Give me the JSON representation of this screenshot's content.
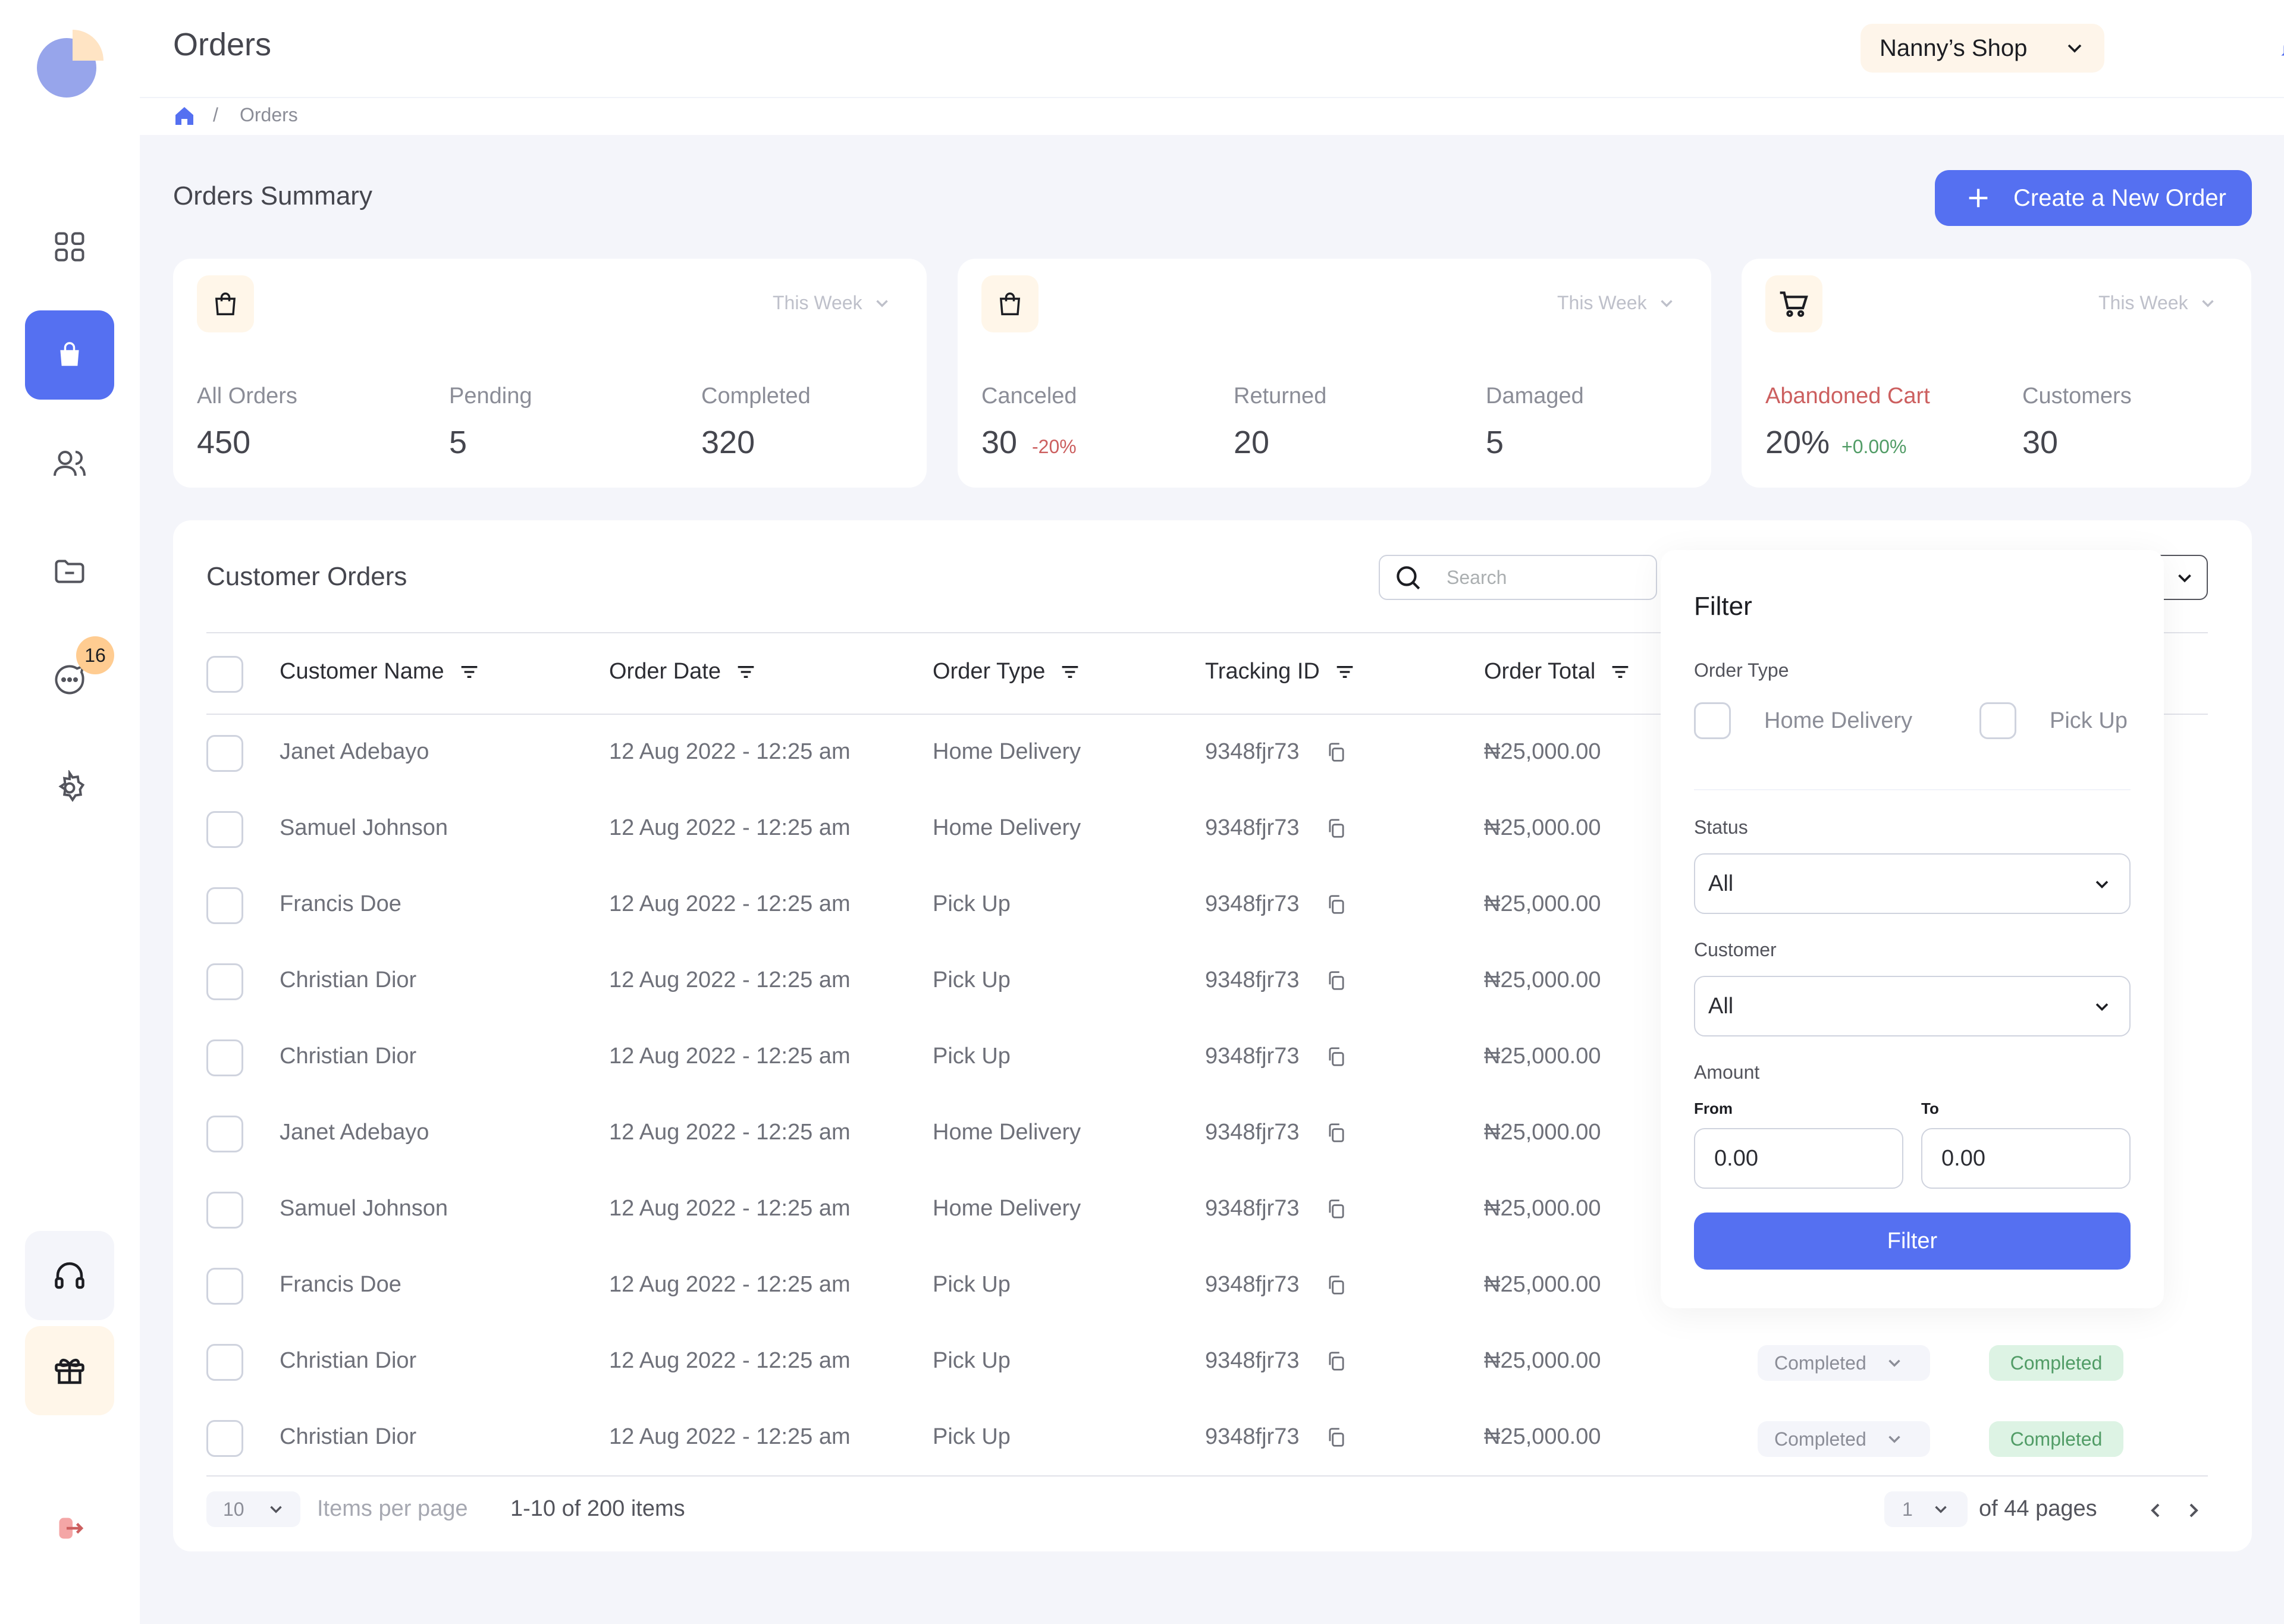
{
  "header": {
    "title": "Orders",
    "shop_name": "Nanny’s Shop"
  },
  "breadcrumb": {
    "current": "Orders",
    "separator": "/"
  },
  "sidebar": {
    "chat_badge": "16",
    "items": [
      {
        "icon": "dashboard-icon"
      },
      {
        "icon": "bag-icon"
      },
      {
        "icon": "users-icon"
      },
      {
        "icon": "folder-icon"
      },
      {
        "icon": "chat-icon"
      },
      {
        "icon": "settings-icon"
      }
    ]
  },
  "summary": {
    "title": "Orders Summary",
    "create_button": "Create a New Order",
    "cards": [
      {
        "period": "This Week",
        "stats": [
          {
            "label": "All Orders",
            "value": "450"
          },
          {
            "label": "Pending",
            "value": "5"
          },
          {
            "label": "Completed",
            "value": "320"
          }
        ]
      },
      {
        "period": "This Week",
        "stats": [
          {
            "label": "Canceled",
            "value": "30",
            "delta": "-20%"
          },
          {
            "label": "Returned",
            "value": "20"
          },
          {
            "label": "Damaged",
            "value": "5"
          }
        ]
      },
      {
        "period": "This Week",
        "stats": [
          {
            "label": "Abandoned Cart",
            "value": "20%",
            "delta": "+0.00%"
          },
          {
            "label": "Customers",
            "value": "30"
          }
        ]
      }
    ]
  },
  "orders": {
    "title": "Customer Orders",
    "search_placeholder": "Search",
    "columns": [
      "Customer Name",
      "Order Date",
      "Order Type",
      "Tracking ID",
      "Order Total"
    ],
    "rows": [
      {
        "name": "Janet Adebayo",
        "date": "12 Aug 2022 - 12:25 am",
        "type": "Home Delivery",
        "tracking": "9348fjr73",
        "total": "₦25,000.00"
      },
      {
        "name": "Samuel Johnson",
        "date": "12 Aug 2022 - 12:25 am",
        "type": "Home Delivery",
        "tracking": "9348fjr73",
        "total": "₦25,000.00"
      },
      {
        "name": "Francis Doe",
        "date": "12 Aug 2022 - 12:25 am",
        "type": "Pick Up",
        "tracking": "9348fjr73",
        "total": "₦25,000.00"
      },
      {
        "name": "Christian Dior",
        "date": "12 Aug 2022 - 12:25 am",
        "type": "Pick Up",
        "tracking": "9348fjr73",
        "total": "₦25,000.00"
      },
      {
        "name": "Christian Dior",
        "date": "12 Aug 2022 - 12:25 am",
        "type": "Pick Up",
        "tracking": "9348fjr73",
        "total": "₦25,000.00"
      },
      {
        "name": "Janet Adebayo",
        "date": "12 Aug 2022 - 12:25 am",
        "type": "Home Delivery",
        "tracking": "9348fjr73",
        "total": "₦25,000.00"
      },
      {
        "name": "Samuel Johnson",
        "date": "12 Aug 2022 - 12:25 am",
        "type": "Home Delivery",
        "tracking": "9348fjr73",
        "total": "₦25,000.00"
      },
      {
        "name": "Francis Doe",
        "date": "12 Aug 2022 - 12:25 am",
        "type": "Pick Up",
        "tracking": "9348fjr73",
        "total": "₦25,000.00"
      },
      {
        "name": "Christian Dior",
        "date": "12 Aug 2022 - 12:25 am",
        "type": "Pick Up",
        "tracking": "9348fjr73",
        "total": "₦25,000.00",
        "action": "Completed",
        "status": "Completed"
      },
      {
        "name": "Christian Dior",
        "date": "12 Aug 2022 - 12:25 am",
        "type": "Pick Up",
        "tracking": "9348fjr73",
        "total": "₦25,000.00",
        "action": "Completed",
        "status": "Completed"
      }
    ],
    "pagination": {
      "per_page": "10",
      "per_page_label": "Items per page",
      "range": "1-10 of 200 items",
      "page": "1",
      "of_pages": "of 44 pages"
    }
  },
  "filter": {
    "title": "Filter",
    "order_type_label": "Order Type",
    "order_types": [
      "Home Delivery",
      "Pick Up"
    ],
    "status_label": "Status",
    "status_value": "All",
    "customer_label": "Customer",
    "customer_value": "All",
    "amount_label": "Amount",
    "from_label": "From",
    "to_label": "To",
    "from_value": "0.00",
    "to_value": "0.00",
    "button": "Filter"
  },
  "colors": {
    "primary": "#5570F1",
    "accent": "#FFCC91",
    "danger": "#CC5F5F",
    "success": "#519C66"
  }
}
